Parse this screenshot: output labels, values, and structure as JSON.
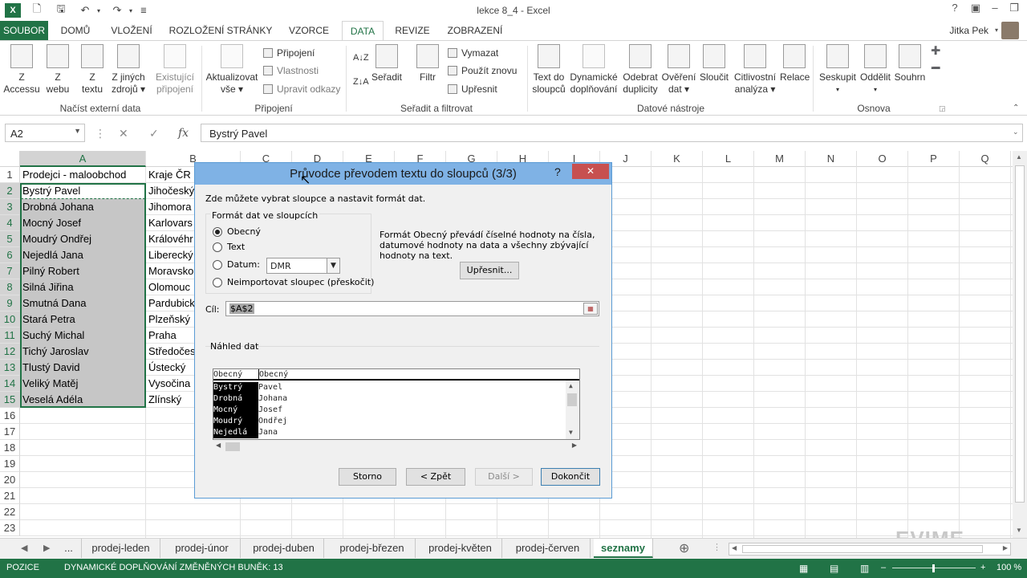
{
  "window": {
    "title": "lekce 8_4 - Excel",
    "logo": "X"
  },
  "tabs": {
    "file": "SOUBOR",
    "items": [
      "DOMŮ",
      "VLOŽENÍ",
      "ROZLOŽENÍ STRÁNKY",
      "VZORCE",
      "DATA",
      "REVIZE",
      "ZOBRAZENÍ"
    ],
    "active": "DATA"
  },
  "user": {
    "name": "Jitka Pek"
  },
  "ribbon": {
    "external": {
      "label": "Načíst externí data",
      "access": [
        "Z",
        "Accessu"
      ],
      "web": [
        "Z",
        "webu"
      ],
      "text": [
        "Z",
        "textu"
      ],
      "other": [
        "Z jiných",
        "zdrojů ▾"
      ],
      "existing": [
        "Existující",
        "připojení"
      ]
    },
    "connections": {
      "label": "Připojení",
      "refresh": [
        "Aktualizovat",
        "vše ▾"
      ],
      "connections": "Připojení",
      "properties": "Vlastnosti",
      "edit_links": "Upravit odkazy"
    },
    "sort": {
      "label": "Seřadit a filtrovat",
      "sort": "Seřadit",
      "filter": "Filtr",
      "clear": "Vymazat",
      "reapply": "Použít znovu",
      "advanced": "Upřesnit"
    },
    "tools": {
      "label": "Datové nástroje",
      "text_to_cols": [
        "Text do",
        "sloupců"
      ],
      "flash_fill": [
        "Dynamické",
        "doplňování"
      ],
      "remove_dup": [
        "Odebrat",
        "duplicity"
      ],
      "validation": [
        "Ověření",
        "dat ▾"
      ],
      "consolidate": "Sloučit",
      "what_if": [
        "Citlivostní",
        "analýza ▾"
      ],
      "relations": "Relace"
    },
    "outline": {
      "label": "Osnova",
      "group": [
        "Seskupit",
        "▾"
      ],
      "ungroup": [
        "Oddělit",
        "▾"
      ],
      "subtotal": "Souhrn"
    }
  },
  "formula_bar": {
    "name_box": "A2",
    "fx": "fx",
    "value": "Bystrý Pavel"
  },
  "grid": {
    "columns": [
      "A",
      "B",
      "C",
      "D",
      "E",
      "F",
      "G",
      "H",
      "I",
      "J",
      "K",
      "L",
      "M",
      "N",
      "O",
      "P",
      "Q"
    ],
    "rows": [
      "1",
      "2",
      "3",
      "4",
      "5",
      "6",
      "7",
      "8",
      "9",
      "10",
      "11",
      "12",
      "13",
      "14",
      "15",
      "16",
      "17",
      "18",
      "19",
      "20",
      "21",
      "22",
      "23"
    ],
    "col_a": [
      "Prodejci - maloobchod",
      "Bystrý Pavel",
      "Drobná Johana",
      "Mocný Josef",
      "Moudrý Ondřej",
      "Nejedlá Jana",
      "Pilný Robert",
      "Silná Jiřina",
      "Smutná Dana",
      "Stará Petra",
      "Suchý Michal",
      "Tichý Jaroslav",
      "Tlustý David",
      "Veliký Matěj",
      "Veselá Adéla"
    ],
    "col_b": [
      "Kraje ČR",
      "Jihočeský",
      "Jihomora",
      "Karlovars",
      "Královéhr",
      "Liberecký",
      "Moravsko",
      "Olomouc",
      "Pardubick",
      "Plzeňský",
      "Praha",
      "Středočes",
      "Ústecký",
      "Vysočina",
      "Zlínský"
    ]
  },
  "sheets": {
    "ellipsis": "...",
    "items": [
      "prodej-leden",
      "prodej-únor",
      "prodej-duben",
      "prodej-březen",
      "prodej-květen",
      "prodej-červen",
      "seznamy"
    ],
    "active": "seznamy",
    "add": "⊕"
  },
  "status": {
    "mode": "POZICE",
    "message": "DYNAMICKÉ DOPLŇOVÁNÍ ZMĚNĚNÝCH BUNĚK: 13",
    "zoom": "100 %"
  },
  "watermark": "EVIME",
  "dialog": {
    "title": "Průvodce převodem textu do sloupců (3/3)",
    "help": "?",
    "close": "✕",
    "intro": "Zde můžete vybrat sloupce a nastavit formát dat.",
    "format_group": "Formát dat ve sloupcích",
    "options": {
      "general": "Obecný",
      "text": "Text",
      "date": "Datum:",
      "skip": "Neimportovat sloupec (přeskočit)"
    },
    "date_format": "DMR",
    "description": [
      "Formát Obecný převádí číselné hodnoty na čísla,",
      "datumové hodnoty na data a všechny zbývající",
      "hodnoty na text."
    ],
    "advanced": "Upřesnit...",
    "dest_label": "Cíl:",
    "dest_value": "$A$2",
    "preview_label": "Náhled dat",
    "preview_headers": [
      "Obecný",
      "Obecný"
    ],
    "preview_rows": [
      [
        "Bystrý",
        "Pavel"
      ],
      [
        "Drobná",
        "Johana"
      ],
      [
        "Mocný",
        "Josef"
      ],
      [
        "Moudrý",
        "Ondřej"
      ],
      [
        "Nejedlá",
        "Jana"
      ]
    ],
    "buttons": {
      "cancel": "Storno",
      "back": "< Zpět",
      "next": "Další >",
      "finish": "Dokončit"
    }
  }
}
